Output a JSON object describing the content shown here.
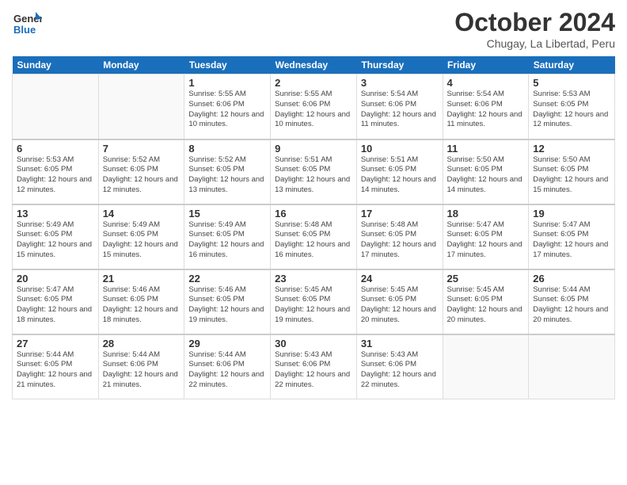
{
  "header": {
    "logo_general": "General",
    "logo_blue": "Blue",
    "month_year": "October 2024",
    "location": "Chugay, La Libertad, Peru"
  },
  "weekdays": [
    "Sunday",
    "Monday",
    "Tuesday",
    "Wednesday",
    "Thursday",
    "Friday",
    "Saturday"
  ],
  "weeks": [
    [
      null,
      null,
      {
        "day": "1",
        "sunrise": "Sunrise: 5:55 AM",
        "sunset": "Sunset: 6:06 PM",
        "daylight": "Daylight: 12 hours and 10 minutes."
      },
      {
        "day": "2",
        "sunrise": "Sunrise: 5:55 AM",
        "sunset": "Sunset: 6:06 PM",
        "daylight": "Daylight: 12 hours and 10 minutes."
      },
      {
        "day": "3",
        "sunrise": "Sunrise: 5:54 AM",
        "sunset": "Sunset: 6:06 PM",
        "daylight": "Daylight: 12 hours and 11 minutes."
      },
      {
        "day": "4",
        "sunrise": "Sunrise: 5:54 AM",
        "sunset": "Sunset: 6:06 PM",
        "daylight": "Daylight: 12 hours and 11 minutes."
      },
      {
        "day": "5",
        "sunrise": "Sunrise: 5:53 AM",
        "sunset": "Sunset: 6:05 PM",
        "daylight": "Daylight: 12 hours and 12 minutes."
      }
    ],
    [
      {
        "day": "6",
        "sunrise": "Sunrise: 5:53 AM",
        "sunset": "Sunset: 6:05 PM",
        "daylight": "Daylight: 12 hours and 12 minutes."
      },
      {
        "day": "7",
        "sunrise": "Sunrise: 5:52 AM",
        "sunset": "Sunset: 6:05 PM",
        "daylight": "Daylight: 12 hours and 12 minutes."
      },
      {
        "day": "8",
        "sunrise": "Sunrise: 5:52 AM",
        "sunset": "Sunset: 6:05 PM",
        "daylight": "Daylight: 12 hours and 13 minutes."
      },
      {
        "day": "9",
        "sunrise": "Sunrise: 5:51 AM",
        "sunset": "Sunset: 6:05 PM",
        "daylight": "Daylight: 12 hours and 13 minutes."
      },
      {
        "day": "10",
        "sunrise": "Sunrise: 5:51 AM",
        "sunset": "Sunset: 6:05 PM",
        "daylight": "Daylight: 12 hours and 14 minutes."
      },
      {
        "day": "11",
        "sunrise": "Sunrise: 5:50 AM",
        "sunset": "Sunset: 6:05 PM",
        "daylight": "Daylight: 12 hours and 14 minutes."
      },
      {
        "day": "12",
        "sunrise": "Sunrise: 5:50 AM",
        "sunset": "Sunset: 6:05 PM",
        "daylight": "Daylight: 12 hours and 15 minutes."
      }
    ],
    [
      {
        "day": "13",
        "sunrise": "Sunrise: 5:49 AM",
        "sunset": "Sunset: 6:05 PM",
        "daylight": "Daylight: 12 hours and 15 minutes."
      },
      {
        "day": "14",
        "sunrise": "Sunrise: 5:49 AM",
        "sunset": "Sunset: 6:05 PM",
        "daylight": "Daylight: 12 hours and 15 minutes."
      },
      {
        "day": "15",
        "sunrise": "Sunrise: 5:49 AM",
        "sunset": "Sunset: 6:05 PM",
        "daylight": "Daylight: 12 hours and 16 minutes."
      },
      {
        "day": "16",
        "sunrise": "Sunrise: 5:48 AM",
        "sunset": "Sunset: 6:05 PM",
        "daylight": "Daylight: 12 hours and 16 minutes."
      },
      {
        "day": "17",
        "sunrise": "Sunrise: 5:48 AM",
        "sunset": "Sunset: 6:05 PM",
        "daylight": "Daylight: 12 hours and 17 minutes."
      },
      {
        "day": "18",
        "sunrise": "Sunrise: 5:47 AM",
        "sunset": "Sunset: 6:05 PM",
        "daylight": "Daylight: 12 hours and 17 minutes."
      },
      {
        "day": "19",
        "sunrise": "Sunrise: 5:47 AM",
        "sunset": "Sunset: 6:05 PM",
        "daylight": "Daylight: 12 hours and 17 minutes."
      }
    ],
    [
      {
        "day": "20",
        "sunrise": "Sunrise: 5:47 AM",
        "sunset": "Sunset: 6:05 PM",
        "daylight": "Daylight: 12 hours and 18 minutes."
      },
      {
        "day": "21",
        "sunrise": "Sunrise: 5:46 AM",
        "sunset": "Sunset: 6:05 PM",
        "daylight": "Daylight: 12 hours and 18 minutes."
      },
      {
        "day": "22",
        "sunrise": "Sunrise: 5:46 AM",
        "sunset": "Sunset: 6:05 PM",
        "daylight": "Daylight: 12 hours and 19 minutes."
      },
      {
        "day": "23",
        "sunrise": "Sunrise: 5:45 AM",
        "sunset": "Sunset: 6:05 PM",
        "daylight": "Daylight: 12 hours and 19 minutes."
      },
      {
        "day": "24",
        "sunrise": "Sunrise: 5:45 AM",
        "sunset": "Sunset: 6:05 PM",
        "daylight": "Daylight: 12 hours and 20 minutes."
      },
      {
        "day": "25",
        "sunrise": "Sunrise: 5:45 AM",
        "sunset": "Sunset: 6:05 PM",
        "daylight": "Daylight: 12 hours and 20 minutes."
      },
      {
        "day": "26",
        "sunrise": "Sunrise: 5:44 AM",
        "sunset": "Sunset: 6:05 PM",
        "daylight": "Daylight: 12 hours and 20 minutes."
      }
    ],
    [
      {
        "day": "27",
        "sunrise": "Sunrise: 5:44 AM",
        "sunset": "Sunset: 6:05 PM",
        "daylight": "Daylight: 12 hours and 21 minutes."
      },
      {
        "day": "28",
        "sunrise": "Sunrise: 5:44 AM",
        "sunset": "Sunset: 6:06 PM",
        "daylight": "Daylight: 12 hours and 21 minutes."
      },
      {
        "day": "29",
        "sunrise": "Sunrise: 5:44 AM",
        "sunset": "Sunset: 6:06 PM",
        "daylight": "Daylight: 12 hours and 22 minutes."
      },
      {
        "day": "30",
        "sunrise": "Sunrise: 5:43 AM",
        "sunset": "Sunset: 6:06 PM",
        "daylight": "Daylight: 12 hours and 22 minutes."
      },
      {
        "day": "31",
        "sunrise": "Sunrise: 5:43 AM",
        "sunset": "Sunset: 6:06 PM",
        "daylight": "Daylight: 12 hours and 22 minutes."
      },
      null,
      null
    ]
  ]
}
